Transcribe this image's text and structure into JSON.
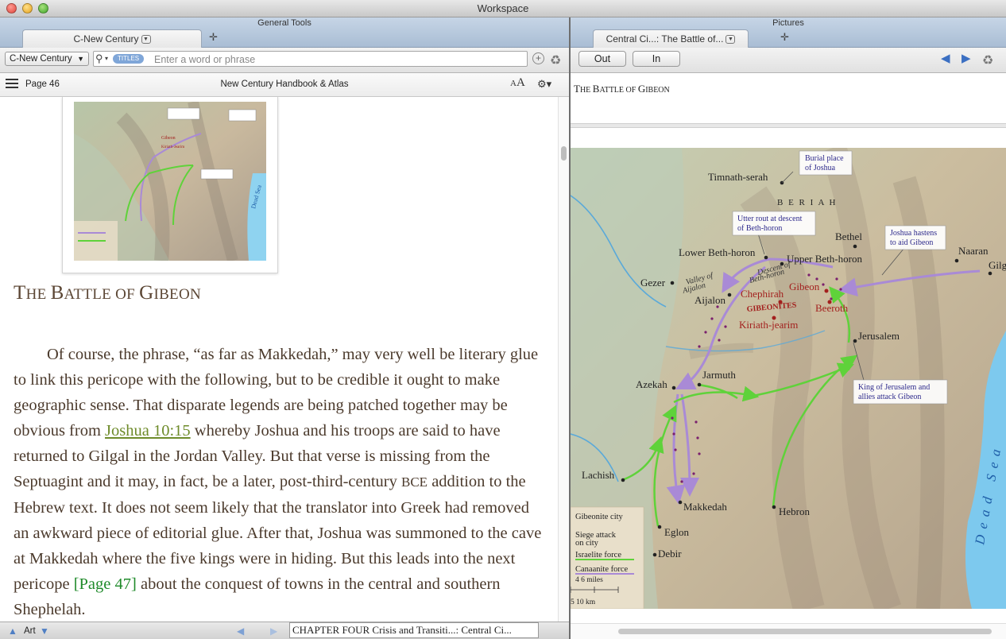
{
  "window": {
    "title": "Workspace"
  },
  "left": {
    "header_title": "General Tools",
    "tab_label": "C-New Century",
    "library_select": "C-New Century",
    "search": {
      "pill": "TITLES",
      "placeholder": "Enter a word or phrase",
      "value": ""
    },
    "reader": {
      "page": "Page 46",
      "book_title": "New Century Handbook & Atlas"
    },
    "thumb_labels": {
      "l1": "Gibeon",
      "l2": "Kiriath-Jearim"
    },
    "heading_first": "T",
    "heading_rest": "HE ",
    "heading_b": "B",
    "heading_attle": "ATTLE OF ",
    "heading_g": "G",
    "heading_ibeon": "IBEON",
    "body": {
      "p1": "Of course, the phrase, “as far as Makkedah,” may very well be literary glue to link this pericope with the following, but to be credible it ought to make geographic sense. That disparate legends are being patched together may be obvious from ",
      "link_joshua": "Joshua 10:15",
      "p2": " whereby Joshua and his troops are said to have returned to Gilgal in the Jordan Valley. But that verse is missing from the Septuagint and it may, in fact, be a later, post-third-century ",
      "bce": "BCE",
      "p3": " addition to the Hebrew text. It does not seem likely that the translator into Greek had removed an awkward piece of editorial glue. After that, Joshua was summoned to the cave at Makkedah where the five kings were in hiding. But this leads into the next pericope ",
      "link_page47": "[Page 47]",
      "p4": " about the conquest of towns in the central and southern Shephelah."
    },
    "status": {
      "art_label": "Art",
      "location": "CHAPTER FOUR Crisis and Transiti...: Central Ci..."
    }
  },
  "right": {
    "header_title": "Pictures",
    "tab_label": "Central Ci...: The Battle of...",
    "zoom_out_label": "Out",
    "zoom_in_label": "In",
    "caption": {
      "t": "T",
      "he": "HE ",
      "b": "B",
      "attle": "ATTLE OF ",
      "g": "G",
      "ibeon": "IBEON"
    },
    "map": {
      "places": {
        "timnath": "Timnath-serah",
        "beriah": "B E R I A H",
        "bethel": "Bethel",
        "naaran": "Naaran",
        "gilgal": "Gilga",
        "lower_bh": "Lower Beth-horon",
        "upper_bh": "Upper Beth-horon",
        "gezer": "Gezer",
        "aijalon": "Aijalon",
        "valley1": "Valley of",
        "valley2": "Aijalon",
        "descent1": "Descent of",
        "descent2": "Beth-horon",
        "gibeon": "Gibeon",
        "chephirah": "Chephirah",
        "gibeonites": "GIBEONITES",
        "beeroth": "Beeroth",
        "kiriath": "Kiriath-jearim",
        "jerusalem": "Jerusalem",
        "jarmuth": "Jarmuth",
        "azekah": "Azekah",
        "lachish": "Lachish",
        "makkedah": "Makkedah",
        "hebron": "Hebron",
        "eglon": "Eglon",
        "debir": "Debir",
        "dead_sea": "Dead Sea"
      },
      "callouts": {
        "burial1": "Burial place",
        "burial2": "of Joshua",
        "rout1": "Utter rout at descent",
        "rout2": "of Beth-horon",
        "hastens1": "Joshua hastens",
        "hastens2": "to aid Gibeon",
        "king1": "King of Jerusalem and",
        "king2": "allies attack Gibeon"
      },
      "legend": {
        "city": "Gibeonite city",
        "siege1": "Siege attack",
        "siege2": "on city",
        "israelite": "Israelite force",
        "canaanite": "Canaanite force",
        "miles": "4   6  miles",
        "km": "5      10  km"
      }
    }
  },
  "colors": {
    "heading": "#5b4634",
    "body_text": "#4b3a2c",
    "link": "#6e8b2a",
    "page_link": "#1f8a2a",
    "israelite_arrow": "#5fd23a",
    "canaanite_arrow": "#a98ad6",
    "callout_text": "#2e2a8c",
    "gibeonite_text": "#a3201e",
    "sea": "#7dc9ee"
  }
}
